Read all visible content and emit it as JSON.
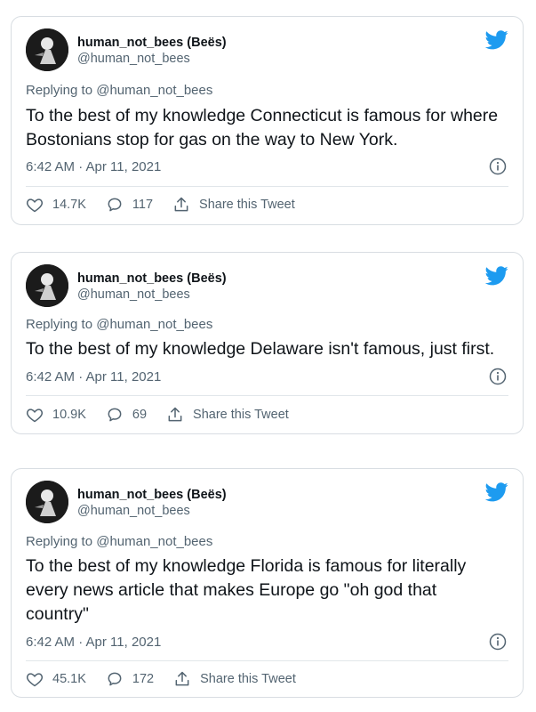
{
  "colors": {
    "accent": "#1d9bf0",
    "text_primary": "#0f1419",
    "text_secondary": "#536471",
    "border": "#d8dde2"
  },
  "icons": {
    "brand": "twitter-bird-icon",
    "like": "heart-icon",
    "reply": "reply-bubble-icon",
    "share": "share-upload-icon",
    "info": "info-icon"
  },
  "tweets": [
    {
      "display_name": "human_not_bees (Beës)",
      "handle": "@human_not_bees",
      "replying_to": "Replying to @human_not_bees",
      "text": "To the best of my knowledge Connecticut is famous for where Bostonians stop for gas on the way to New York.",
      "timestamp": "6:42 AM · Apr 11, 2021",
      "likes": "14.7K",
      "replies": "117",
      "share_label": "Share this Tweet"
    },
    {
      "display_name": "human_not_bees (Beës)",
      "handle": "@human_not_bees",
      "replying_to": "Replying to @human_not_bees",
      "text": "To the best of my knowledge Delaware isn't famous, just first.",
      "timestamp": "6:42 AM · Apr 11, 2021",
      "likes": "10.9K",
      "replies": "69",
      "share_label": "Share this Tweet"
    },
    {
      "display_name": "human_not_bees (Beës)",
      "handle": "@human_not_bees",
      "replying_to": "Replying to @human_not_bees",
      "text": "To the best of my knowledge Florida is famous for literally every news article that makes Europe go \"oh god that country\"",
      "timestamp": "6:42 AM · Apr 11, 2021",
      "likes": "45.1K",
      "replies": "172",
      "share_label": "Share this Tweet"
    }
  ]
}
